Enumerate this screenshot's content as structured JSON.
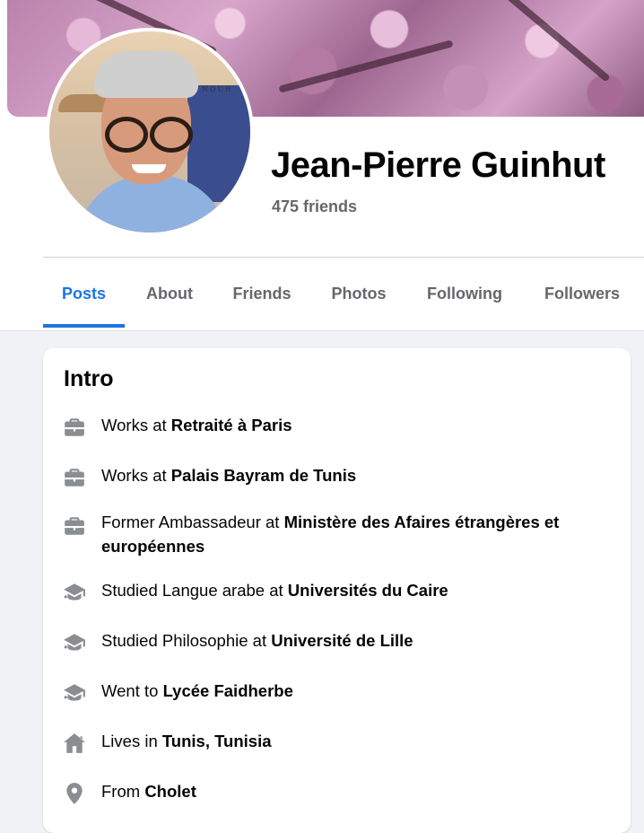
{
  "profile": {
    "name": "Jean-Pierre Guinhut",
    "friends": "475 friends",
    "avatar_caption": "NOUR"
  },
  "tabs": [
    {
      "label": "Posts",
      "active": true
    },
    {
      "label": "About",
      "active": false
    },
    {
      "label": "Friends",
      "active": false
    },
    {
      "label": "Photos",
      "active": false
    },
    {
      "label": "Following",
      "active": false
    },
    {
      "label": "Followers",
      "active": false
    }
  ],
  "intro": {
    "title": "Intro",
    "items": [
      {
        "icon": "briefcase-icon",
        "prefix": "Works at ",
        "bold": "Retraité à Paris"
      },
      {
        "icon": "briefcase-icon",
        "prefix": "Works at ",
        "bold": "Palais Bayram de Tunis"
      },
      {
        "icon": "briefcase-icon",
        "prefix": "Former Ambassadeur at ",
        "bold": "Ministère des Afaires étrangères et européennes"
      },
      {
        "icon": "graduation-cap-icon",
        "prefix": "Studied Langue arabe at ",
        "bold": "Universités du Caire"
      },
      {
        "icon": "graduation-cap-icon",
        "prefix": "Studied Philosophie at ",
        "bold": "Université de Lille"
      },
      {
        "icon": "graduation-cap-icon",
        "prefix": "Went to ",
        "bold": "Lycée Faidherbe"
      },
      {
        "icon": "home-icon",
        "prefix": "Lives in ",
        "bold": "Tunis, Tunisia"
      },
      {
        "icon": "location-pin-icon",
        "prefix": "From ",
        "bold": "Cholet"
      }
    ]
  },
  "colors": {
    "accent": "#1b74e4",
    "muted_text": "#65676b",
    "icon_gray": "#8a8d91",
    "page_bg": "#f0f2f5"
  }
}
